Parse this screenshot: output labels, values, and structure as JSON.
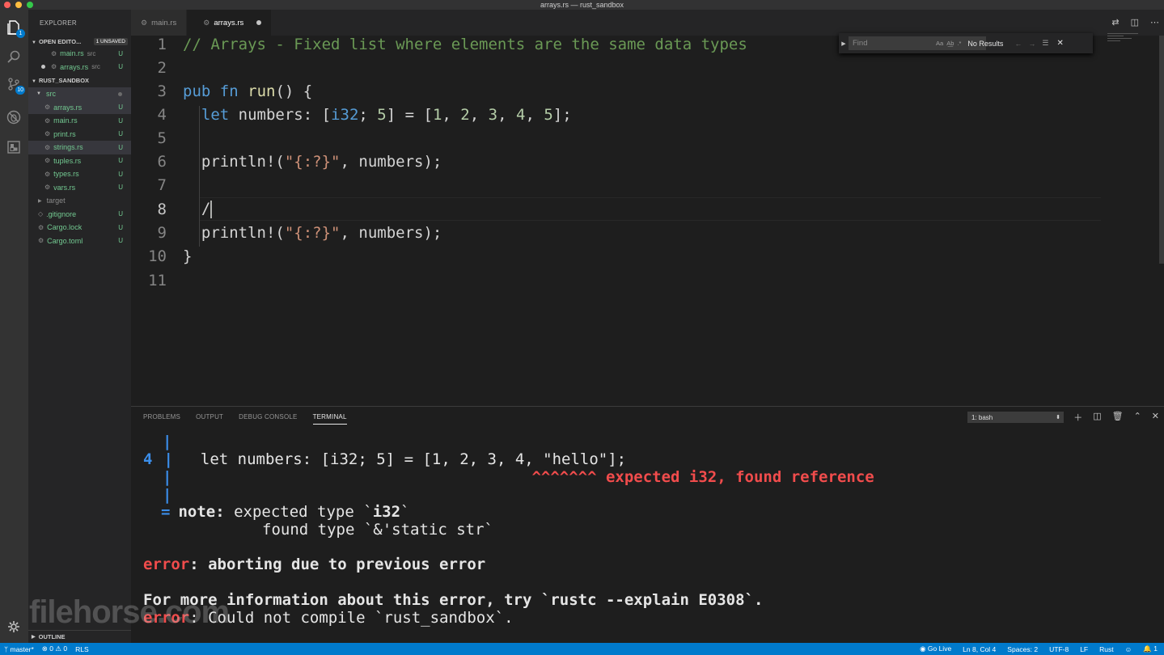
{
  "window": {
    "title": "arrays.rs — rust_sandbox"
  },
  "activity": {
    "explorer_badge": "1",
    "scm_badge": "10"
  },
  "sidebar": {
    "title": "EXPLORER",
    "open_editors": {
      "label": "OPEN EDITO...",
      "unsaved": "1 UNSAVED",
      "items": [
        {
          "name": "main.rs",
          "folder": "src",
          "status": "U"
        },
        {
          "name": "arrays.rs",
          "folder": "src",
          "status": "U"
        }
      ]
    },
    "project": {
      "label": "RUST_SANDBOX"
    },
    "folder_src": "src",
    "files": [
      {
        "name": "arrays.rs",
        "status": "U"
      },
      {
        "name": "main.rs",
        "status": "U"
      },
      {
        "name": "print.rs",
        "status": "U"
      },
      {
        "name": "strings.rs",
        "status": "U"
      },
      {
        "name": "tuples.rs",
        "status": "U"
      },
      {
        "name": "types.rs",
        "status": "U"
      },
      {
        "name": "vars.rs",
        "status": "U"
      }
    ],
    "folder_target": "target",
    "root_files": [
      {
        "name": ".gitignore",
        "status": "U"
      },
      {
        "name": "Cargo.lock",
        "status": "U"
      },
      {
        "name": "Cargo.toml",
        "status": "U"
      }
    ],
    "outline": "OUTLINE"
  },
  "tabs": [
    {
      "label": "main.rs"
    },
    {
      "label": "arrays.rs"
    }
  ],
  "find": {
    "placeholder": "Find",
    "opt_case": "Aa",
    "opt_word": "A͟b",
    "opt_regex": ".*",
    "result": "No Results"
  },
  "editor": {
    "line_numbers": [
      "1",
      "2",
      "3",
      "4",
      "5",
      "6",
      "7",
      "8",
      "9",
      "10",
      "11"
    ],
    "l1": "// Arrays - Fixed list where elements are the same data types",
    "l3": {
      "kw1": "pub",
      "kw2": "fn",
      "fn": "run",
      "rest": "() {"
    },
    "l4": {
      "kw": "let",
      "var": "numbers",
      "colon": ": [",
      "ty": "i32",
      "semi": "; ",
      "n5": "5",
      "eq": "] = [",
      "a": "1",
      "c1": ", ",
      "b": "2",
      "c2": ", ",
      "c": "3",
      "c3": ", ",
      "d": "4",
      "c4": ", ",
      "e": "5",
      "end": "];"
    },
    "l6": {
      "fn": "println!",
      "open": "(",
      "str": "\"{:?}\"",
      "rest": ", numbers);"
    },
    "l8": "/",
    "l9": {
      "fn": "println!",
      "open": "(",
      "str": "\"{:?}\"",
      "rest": ", numbers);"
    },
    "l10": "}"
  },
  "panel": {
    "tabs": [
      "PROBLEMS",
      "OUTPUT",
      "DEBUG CONSOLE",
      "TERMINAL"
    ],
    "terminal_select": "1: bash",
    "term": {
      "pipe": "|",
      "lnum": "4",
      "code": "let numbers: [i32; 5] = [1, 2, 3, 4, \"hello\"];",
      "carets": "^^^^^^^ expected i32, found reference",
      "eq": "=",
      "note": "note:",
      "note_rest": " expected type `",
      "note_ty": "i32",
      "note_end": "`",
      "found": "found type `&'static str`",
      "error": "error",
      "abort": ": aborting due to previous error",
      "more": "For more information about this error, try `rustc --explain E0308`.",
      "error2": "error",
      "compile": ": Could not compile `rust_sandbox`."
    }
  },
  "watermark": "filehorse.com",
  "status": {
    "branch": "master*",
    "errors": "0",
    "warnings": "0",
    "rls": "RLS",
    "golive": "Go Live",
    "position": "Ln 8, Col 4",
    "spaces": "Spaces: 2",
    "encoding": "UTF-8",
    "eol": "LF",
    "lang": "Rust",
    "bell": "1"
  }
}
